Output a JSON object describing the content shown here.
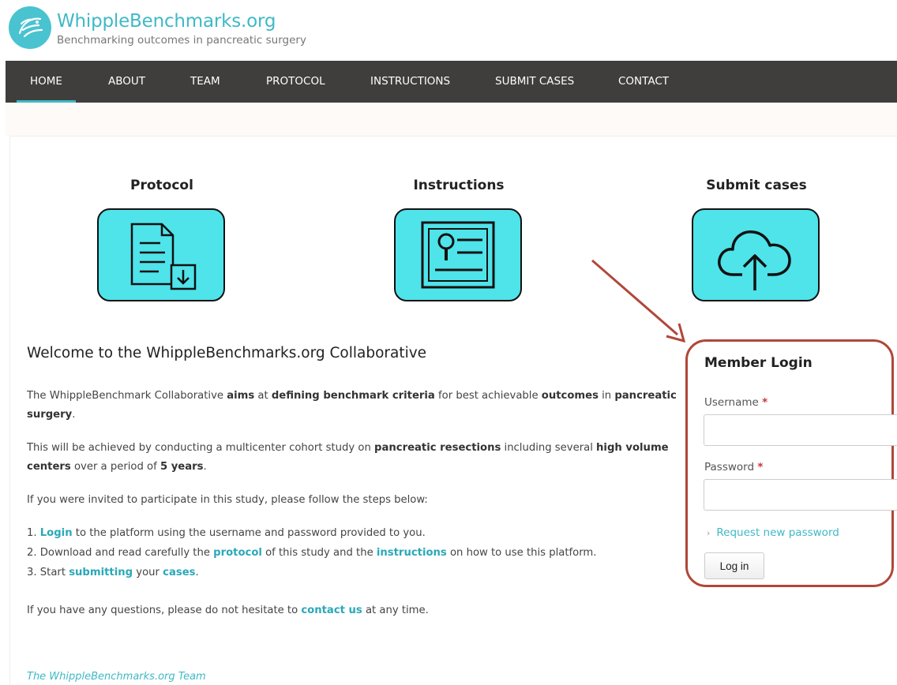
{
  "site": {
    "name": "WhippleBenchmarks.org",
    "slogan": "Benchmarking outcomes in pancreatic surgery"
  },
  "nav": [
    "HOME",
    "ABOUT",
    "TEAM",
    "PROTOCOL",
    "INSTRUCTIONS",
    "SUBMIT CASES",
    "CONTACT"
  ],
  "nav_active": "HOME",
  "tiles": [
    {
      "title": "Protocol",
      "icon": "document-download-icon"
    },
    {
      "title": "Instructions",
      "icon": "search-list-icon"
    },
    {
      "title": "Submit cases",
      "icon": "cloud-upload-icon"
    }
  ],
  "welcome": {
    "heading": "Welcome to the WhippleBenchmarks.org Collaborative",
    "p1": [
      "The WhippleBenchmark Collaborative ",
      "aims",
      " at ",
      "defining benchmark criteria",
      " for best achievable ",
      "outcomes",
      " in ",
      "pancreatic surgery",
      "."
    ],
    "p2": [
      "This will be achieved by conducting a multicenter cohort study on ",
      "pancreatic resections",
      " including several ",
      "high volume centers",
      " over a period of ",
      "5 years",
      "."
    ],
    "p3": "If you were invited to participate in this study, please follow the steps below:",
    "steps": [
      [
        "1. ",
        "Login",
        " to the platform using the username and password provided to you."
      ],
      [
        "2. Download and read carefully the ",
        "protocol",
        " of this study and the ",
        "instructions",
        " on how to use this platform."
      ],
      [
        "3. Start ",
        "submitting",
        " your ",
        "cases",
        "."
      ]
    ],
    "p4": [
      "If you have any questions, please do not hesitate to ",
      "contact us",
      " at any time."
    ],
    "signature": "The WhippleBenchmarks.org Team"
  },
  "login": {
    "title": "Member Login",
    "username_label": "Username",
    "password_label": "Password",
    "required_mark": "*",
    "request_password": "Request new password",
    "button": "Log in"
  },
  "colors": {
    "accent": "#3fb9c6",
    "nav_bg": "#3f3e3c",
    "tile_bg": "#4fe3ea",
    "annotation": "#b0473a"
  }
}
